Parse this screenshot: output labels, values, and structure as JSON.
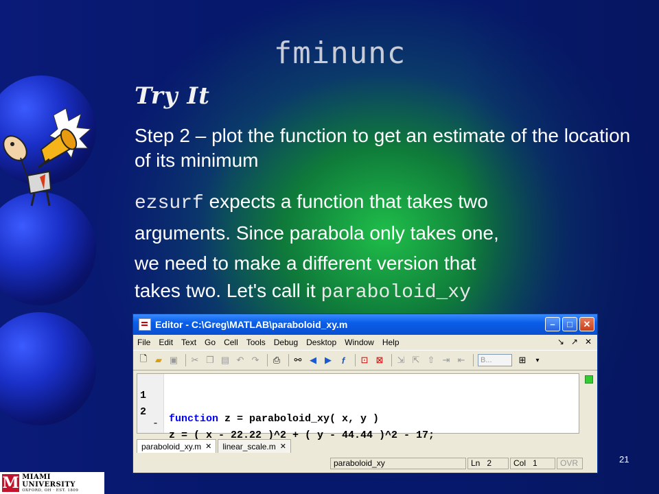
{
  "slide": {
    "title": "fminunc",
    "subtitle": "Try It",
    "paragraph1": "Step 2 – plot the function to get an estimate of the location of its minimum",
    "p2_code": "ezsurf",
    "p2_line1_rest": " expects a function that takes two",
    "p2_line2": "arguments. Since parabola only takes one,",
    "p2_line3": "we need to make a different version that",
    "p2_line4_text": "takes two. Let's call it ",
    "p2_line4_code": "paraboloid_xy",
    "page_number": "21"
  },
  "editor": {
    "window_title": "Editor - C:\\Greg\\MATLAB\\paraboloid_xy.m",
    "menu": [
      "File",
      "Edit",
      "Text",
      "Go",
      "Cell",
      "Tools",
      "Debug",
      "Desktop",
      "Window",
      "Help"
    ],
    "toolbar_combo": "B...",
    "code": [
      {
        "line_no": "1",
        "marker": "",
        "keyword": "function",
        "text": " z = paraboloid_xy( x, y )"
      },
      {
        "line_no": "2",
        "marker": "-",
        "keyword": "",
        "text": "z = ( x - 22.22 )^2 + ( y - 44.44 )^2 - 17;"
      }
    ],
    "tabs": [
      "paraboloid_xy.m",
      "linear_scale.m"
    ],
    "status": {
      "function_name": "paraboloid_xy",
      "ln_label": "Ln",
      "ln_value": "2",
      "col_label": "Col",
      "col_value": "1",
      "mode": "OVR"
    }
  },
  "footer": {
    "logo_text": "MIAMI UNIVERSITY",
    "logo_subtext": "OXFORD, OH · EST. 1809"
  }
}
